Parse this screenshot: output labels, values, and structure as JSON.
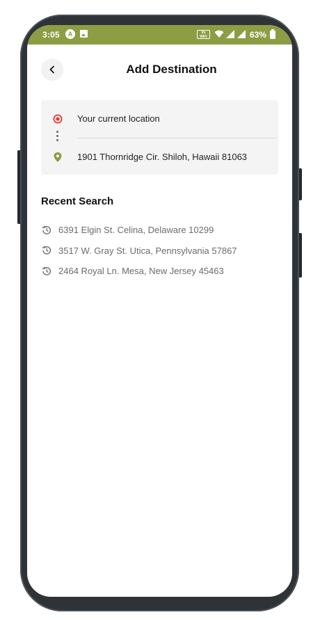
{
  "status_bar": {
    "time": "3:05",
    "a_icon_letter": "A",
    "vowifi": "Vo WiFi",
    "battery": "63%",
    "color": "#8c9d44"
  },
  "header": {
    "back_icon": "chevron-left-icon",
    "title": "Add Destination"
  },
  "route": {
    "origin_icon": "current-location-target-icon",
    "origin_text": "Your current location",
    "destination_icon": "map-pin-icon",
    "destination_text": "1901 Thornridge Cir. Shiloh, Hawaii 81063",
    "origin_color": "#e53935",
    "destination_color": "#8c9d44"
  },
  "recent": {
    "heading": "Recent Search",
    "item_icon": "history-icon",
    "items": [
      "6391 Elgin St. Celina, Delaware 10299",
      "3517 W. Gray St. Utica, Pennsylvania 57867",
      "2464 Royal Ln. Mesa, New Jersey 45463"
    ]
  }
}
